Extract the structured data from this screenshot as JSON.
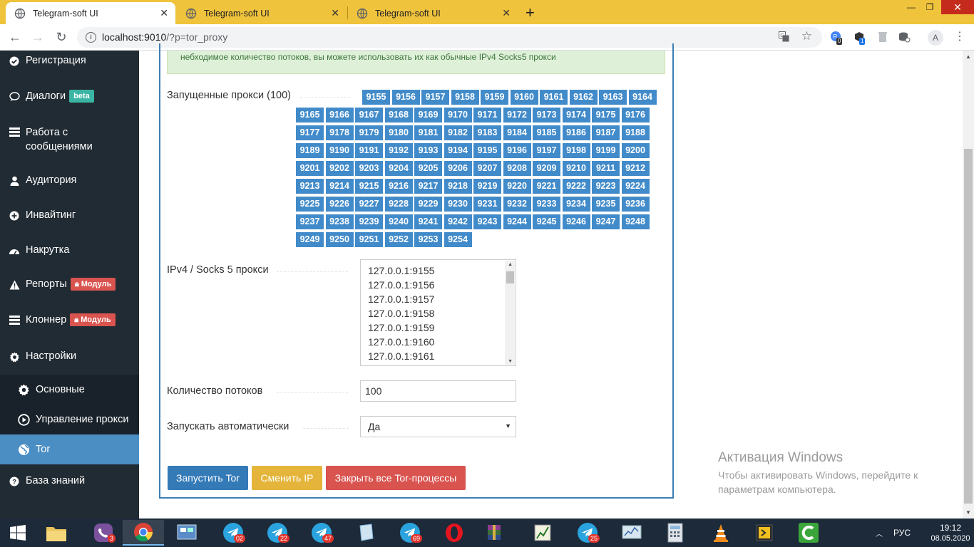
{
  "browser": {
    "tabs": [
      {
        "title": "Telegram-soft UI",
        "active": true
      },
      {
        "title": "Telegram-soft UI",
        "active": false
      },
      {
        "title": "Telegram-soft UI",
        "active": false
      }
    ],
    "url_host": "localhost:9010",
    "url_path": "/?p=tor_proxy",
    "avatar_letter": "A",
    "ext_badges": [
      "0",
      "1"
    ]
  },
  "sidebar": {
    "items": [
      {
        "label": "Регистрация",
        "icon": "check-circle-icon"
      },
      {
        "label": "Диалоги",
        "icon": "comment-icon",
        "badge": "beta"
      },
      {
        "label": "Работа с сообщениями",
        "icon": "list-icon"
      },
      {
        "label": "Аудитория",
        "icon": "user-icon"
      },
      {
        "label": "Инвайтинг",
        "icon": "plus-circle-icon"
      },
      {
        "label": "Накрутка",
        "icon": "dashboard-icon"
      },
      {
        "label": "Репорты",
        "icon": "warning-icon",
        "badge": "Модуль"
      },
      {
        "label": "Клоннер",
        "icon": "list-icon",
        "badge": "Модуль"
      },
      {
        "label": "Настройки",
        "icon": "gear-icon"
      }
    ],
    "subitems": [
      {
        "label": "Основные",
        "icon": "gear-icon"
      },
      {
        "label": "Управление прокси",
        "icon": "play-circle-icon"
      },
      {
        "label": "Tor",
        "icon": "globe-icon",
        "active": true
      }
    ],
    "kb": {
      "label": "База знаний",
      "icon": "question-circle-icon"
    }
  },
  "main": {
    "alert_text": "небходимое количество потоков, вы можете использовать их как обычные IPv4 Socks5 прокси",
    "proxies_label": "Запущенные прокси (100)",
    "ports": [
      "9155",
      "9156",
      "9157",
      "9158",
      "9159",
      "9160",
      "9161",
      "9162",
      "9163",
      "9164",
      "9165",
      "9166",
      "9167",
      "9168",
      "9169",
      "9170",
      "9171",
      "9172",
      "9173",
      "9174",
      "9175",
      "9176",
      "9177",
      "9178",
      "9179",
      "9180",
      "9181",
      "9182",
      "9183",
      "9184",
      "9185",
      "9186",
      "9187",
      "9188",
      "9189",
      "9190",
      "9191",
      "9192",
      "9193",
      "9194",
      "9195",
      "9196",
      "9197",
      "9198",
      "9199",
      "9200",
      "9201",
      "9202",
      "9203",
      "9204",
      "9205",
      "9206",
      "9207",
      "9208",
      "9209",
      "9210",
      "9211",
      "9212",
      "9213",
      "9214",
      "9215",
      "9216",
      "9217",
      "9218",
      "9219",
      "9220",
      "9221",
      "9222",
      "9223",
      "9224",
      "9225",
      "9226",
      "9227",
      "9228",
      "9229",
      "9230",
      "9231",
      "9232",
      "9233",
      "9234",
      "9235",
      "9236",
      "9237",
      "9238",
      "9239",
      "9240",
      "9241",
      "9242",
      "9243",
      "9244",
      "9245",
      "9246",
      "9247",
      "9248",
      "9249",
      "9250",
      "9251",
      "9252",
      "9253",
      "9254"
    ],
    "socks_label": "IPv4 / Socks 5 прокси",
    "socks_list": [
      "127.0.0.1:9155",
      "127.0.0.1:9156",
      "127.0.0.1:9157",
      "127.0.0.1:9158",
      "127.0.0.1:9159",
      "127.0.0.1:9160",
      "127.0.0.1:9161"
    ],
    "threads_label": "Количество потоков",
    "threads_value": "100",
    "autostart_label": "Запускать автоматически",
    "autostart_value": "Да",
    "btn_start": "Запустить Tor",
    "btn_change_ip": "Сменить IP",
    "btn_close_all": "Закрыть все Tor-процессы"
  },
  "activation": {
    "title": "Активация Windows",
    "line1": "Чтобы активировать Windows, перейдите к",
    "line2": "параметрам компьютера."
  },
  "taskbar": {
    "badges": [
      "3",
      "02",
      "22",
      "47",
      "69",
      "25"
    ],
    "lang": "РУС",
    "time": "19:12",
    "date": "08.05.2020"
  },
  "colors": {
    "tabstrip": "#f0c33c",
    "sidebar": "#212b33",
    "active_sub": "#4a8ec4",
    "port": "#428bca",
    "btn_blue": "#337ab7",
    "btn_yellow": "#e5b53b",
    "btn_red": "#d9534f",
    "beta": "#3bb5a3"
  }
}
